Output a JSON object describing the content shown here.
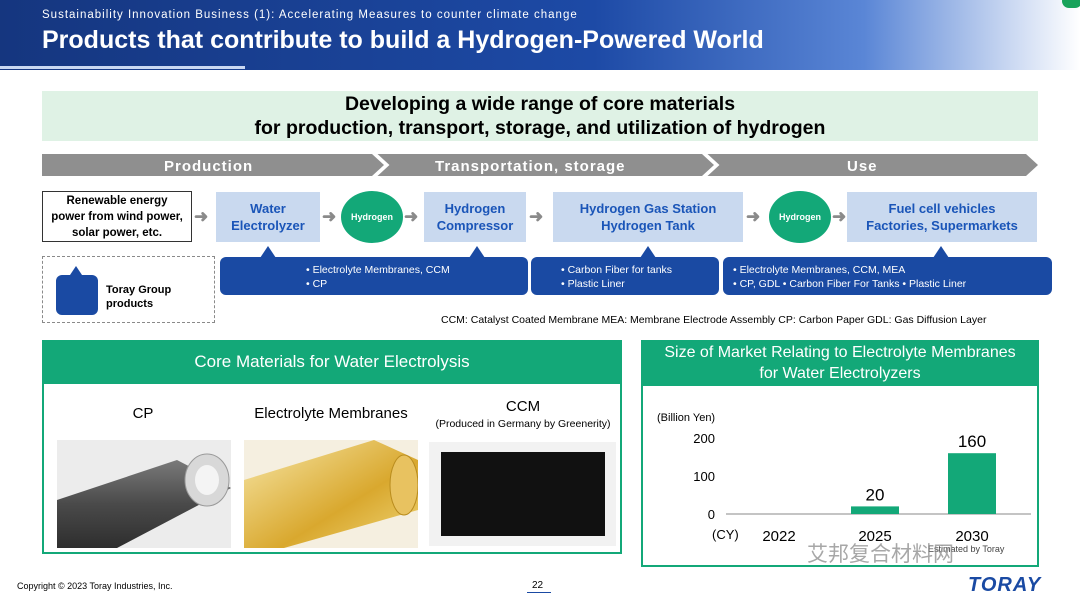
{
  "header": {
    "subtitle": "Sustainability Innovation Business (1): Accelerating Measures to counter climate change",
    "title": "Products that contribute to build a Hydrogen-Powered World"
  },
  "headline": {
    "line1": "Developing a wide range of core materials",
    "line2": "for production, transport, storage, and utilization of hydrogen"
  },
  "stages": [
    "Production",
    "Transportation, storage",
    "Use"
  ],
  "flow": {
    "renewable": [
      "Renewable energy",
      "power from wind power,",
      "solar power, etc."
    ],
    "water_electrolyzer": [
      "Water",
      "Electrolyzer"
    ],
    "hydrogen_1": "Hydrogen",
    "compressor": [
      "Hydrogen",
      "Compressor"
    ],
    "station": [
      "Hydrogen Gas Station",
      "Hydrogen Tank"
    ],
    "hydrogen_2": "Hydrogen",
    "fuel_cell": [
      "Fuel cell vehicles",
      "Factories, Supermarkets"
    ]
  },
  "products": {
    "production": [
      "• Electrolyte Membranes, CCM",
      "• CP"
    ],
    "transport": [
      "• Carbon  Fiber for tanks",
      "• Plastic Liner"
    ],
    "use": [
      "• Electrolyte Membranes, CCM, MEA",
      "• CP, GDL   • Carbon  Fiber For Tanks  • Plastic Liner"
    ]
  },
  "legend": {
    "text": "Toray Group products"
  },
  "abbreviations": "CCM: Catalyst Coated Membrane  MEA: Membrane Electrode Assembly  CP: Carbon Paper    GDL: Gas Diffusion Layer",
  "core_materials": {
    "title": "Core Materials for Water Electrolysis",
    "items": [
      {
        "label": "CP",
        "note": ""
      },
      {
        "label": "Electrolyte Membranes",
        "note": ""
      },
      {
        "label": "CCM",
        "note": "(Produced in Germany by Greenerity)"
      }
    ]
  },
  "market": {
    "title_line1": "Size of Market Relating to Electrolyte Membranes",
    "title_line2": "for Water Electrolyzers"
  },
  "chart_data": {
    "type": "bar",
    "title": "Size of Market Relating to Electrolyte Membranes for Water Electrolyzers",
    "ylabel": "(Billion Yen)",
    "xlabel": "(CY)",
    "categories": [
      "2022",
      "2025",
      "2030"
    ],
    "values": [
      0,
      20,
      160
    ],
    "data_labels": [
      "",
      "20",
      "160"
    ],
    "yticks": [
      "0",
      "100",
      "200"
    ],
    "ylim": [
      0,
      200
    ],
    "color": "#13a878",
    "footnote": "Estimated by Toray",
    "grid": false
  },
  "footer": {
    "copyright": "Copyright © 2023 Toray Industries, Inc.",
    "page": "22",
    "logo": "TORAY",
    "watermark": "艾邦复合材料网"
  },
  "colors": {
    "navy": "#15367f",
    "accent_blue": "#1a4aa3",
    "green": "#13a878",
    "light_green": "#dff2e5",
    "light_blue": "#c9d9ef"
  }
}
